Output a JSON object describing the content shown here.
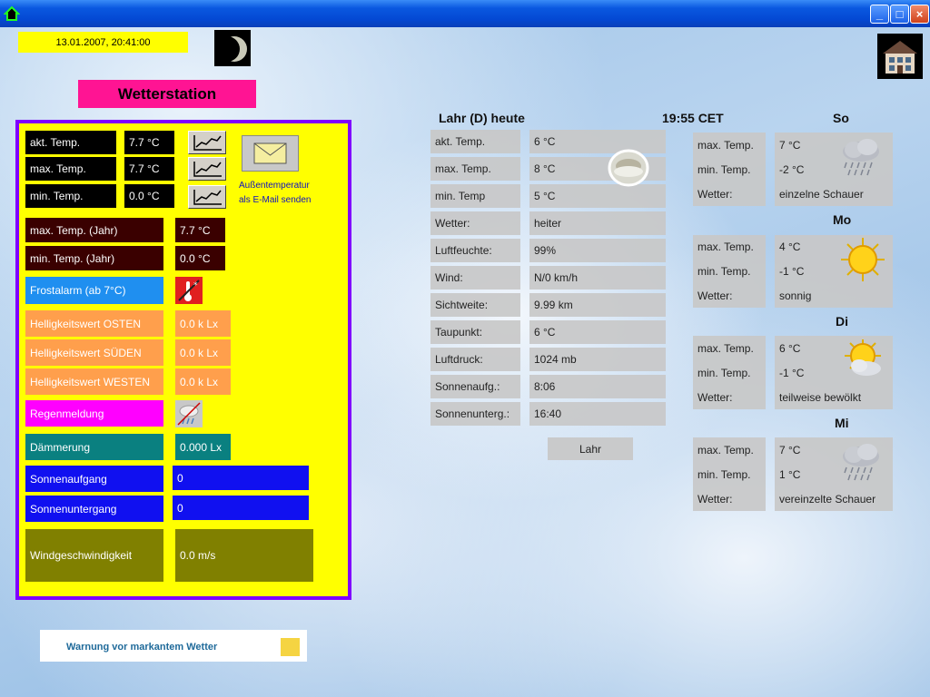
{
  "datetime": "13.01.2007, 20:41:00",
  "title": "Wetterstation",
  "sensors": {
    "akt_label": "akt. Temp.",
    "akt_value": "7.7 °C",
    "max_label": "max. Temp.",
    "max_value": "7.7 °C",
    "min_label": "min. Temp.",
    "min_value": "0.0 °C",
    "email_text_1": "Außentemperatur",
    "email_text_2": "als E-Mail senden",
    "max_year_label": "max. Temp. (Jahr)",
    "max_year_value": "7.7 °C",
    "min_year_label": "min. Temp. (Jahr)",
    "min_year_value": "0.0 °C",
    "frost_label": "Frostalarm (ab 7°C)",
    "bright_east_label": "Helligkeitswert OSTEN",
    "bright_east_value": "0.0 k Lx",
    "bright_south_label": "Helligkeitswert SÜDEN",
    "bright_south_value": "0.0 k Lx",
    "bright_west_label": "Helligkeitswert WESTEN",
    "bright_west_value": "0.0 k Lx",
    "rain_label": "Regenmeldung",
    "dusk_label": "Dämmerung",
    "dusk_value": "0.000 Lx",
    "sunrise_label": "Sonnenaufgang",
    "sunrise_value": "0",
    "sunset_label": "Sonnenuntergang",
    "sunset_value": "0",
    "wind_label": "Windgeschwindigkeit",
    "wind_value": "0.0 m/s"
  },
  "warning": "Warnung vor markantem Wetter",
  "today": {
    "header": "Lahr (D) heute",
    "time": "19:55 CET",
    "rows": [
      {
        "label": "akt. Temp.",
        "value": "6 °C"
      },
      {
        "label": "max. Temp.",
        "value": "8 °C"
      },
      {
        "label": "min. Temp",
        "value": "5 °C"
      },
      {
        "label": "Wetter:",
        "value": "heiter"
      },
      {
        "label": "Luftfeuchte:",
        "value": "99%"
      },
      {
        "label": "Wind:",
        "value": "N/0 km/h"
      },
      {
        "label": "Sichtweite:",
        "value": "9.99 km"
      },
      {
        "label": "Taupunkt:",
        "value": "6 °C"
      },
      {
        "label": "Luftdruck:",
        "value": "1024 mb"
      },
      {
        "label": "Sonnenaufg.:",
        "value": "8:06"
      },
      {
        "label": "Sonnenunterg.:",
        "value": "16:40"
      }
    ],
    "button": "Lahr"
  },
  "forecast": [
    {
      "day": "So",
      "max_label": "max. Temp.",
      "max": "7 °C",
      "min_label": "min. Temp.",
      "min": "-2 °C",
      "wetter_label": "Wetter:",
      "wetter": "einzelne Schauer",
      "icon": "rain-cloud-icon"
    },
    {
      "day": "Mo",
      "max_label": "max. Temp.",
      "max": "4 °C",
      "min_label": "min. Temp.",
      "min": "-1 °C",
      "wetter_label": "Wetter:",
      "wetter": "sonnig",
      "icon": "sun-icon"
    },
    {
      "day": "Di",
      "max_label": "max. Temp.",
      "max": "6 °C",
      "min_label": "min. Temp.",
      "min": "-1 °C",
      "wetter_label": "Wetter:",
      "wetter": "teilweise bewölkt",
      "icon": "sun-cloud-icon"
    },
    {
      "day": "Mi",
      "max_label": "max. Temp.",
      "max": "7 °C",
      "min_label": "min. Temp.",
      "min": "1 °C",
      "wetter_label": "Wetter:",
      "wetter": "vereinzelte Schauer",
      "icon": "rain-cloud-icon"
    }
  ],
  "colors": {
    "panel_bg": "#ffff00",
    "panel_border": "#8000ff",
    "title_bg": "#ff1493",
    "titlebar": "#0a58e0",
    "warning_indicator": "#f5d442"
  }
}
